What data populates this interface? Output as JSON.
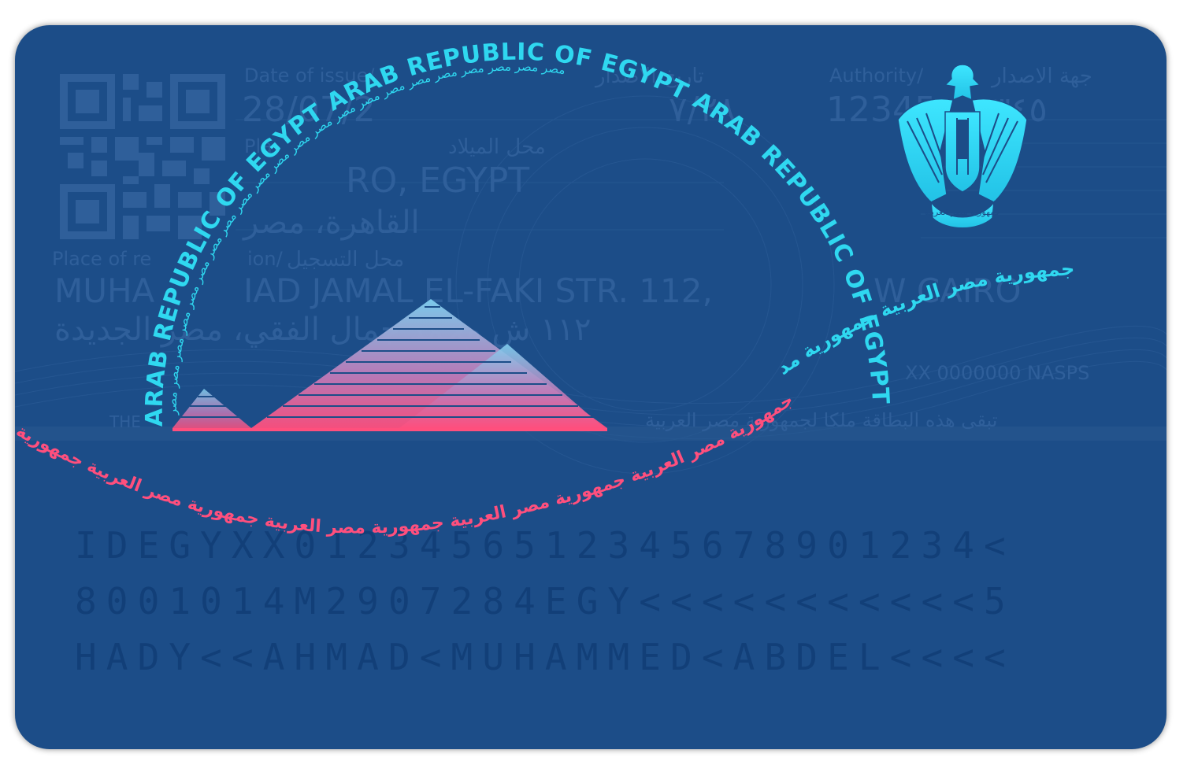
{
  "back": {
    "issue_date": {
      "label_en": "Date of issue/",
      "label_ar": "تاريخ الاصدار",
      "value": "28/07/2",
      "value_ar": "٧/٢٨"
    },
    "authority": {
      "label_en": "Authority/",
      "label_ar": "جهة الاصدار",
      "value": "12345",
      "value_ar": "٣٤٥"
    },
    "place_of_birth": {
      "label_en": "Pla",
      "label_ar": "محل الميلاد",
      "value_en": "RO, EGYPT",
      "value_ar": "القاهرة، مصر"
    },
    "place_of_residence": {
      "label_en": "Place of re",
      "label_en2": "ion/",
      "label_ar": "محل التسجيل",
      "value_en_a": "MUHA",
      "value_en_b": "IAD JAMAL EL-FAKI STR. 112,",
      "value_en_c": "W CAIRO",
      "value_ar": "١١٢ ش محمد جمال الفقي، مصر الجديدة"
    },
    "document_ref": "XX 0000000  NASPS",
    "footer_en": "THE",
    "footer_ar": "تبقى هذه البطاقة ملكا لجمهورية مصر العربية",
    "arc_text_en": "ARAB REPUBLIC OF EGYPT ARAB REPUBLIC OF EGYPT ARAB REPUBLIC OF EGYPT AR",
    "arc_text_ar": "مصر مصر مصر مصر مصر مصر مصر مصر مصر مصر مصر مصر مصر مصر مصر مصر مصر مصر مصر مصر مصر مصر",
    "wave_text_cyan": "جمهورية مصر العربية  جمهورية مد",
    "wave_text_pink": "جمهورية مصر العربية  جمهورية مصر العربية  جمهورية مصر العربية  جمهورية مصر العربية  جمهورية",
    "emblem_caption": "جمهورية مصر العربية",
    "mrz": {
      "line1": "IDEGYXX0123456512345678901234<",
      "line2": "8001014M2907284EGY<<<<<<<<<<<5",
      "line3": "HADY<<AHMAD<MUHAMMED<ABDEL<<<<"
    }
  },
  "colors": {
    "card": "#1c4d88",
    "faint_text": "#2f5f9a",
    "cyan": "#2fd8f0",
    "pink": "#ff4f7d",
    "mrz": "#123f78"
  }
}
